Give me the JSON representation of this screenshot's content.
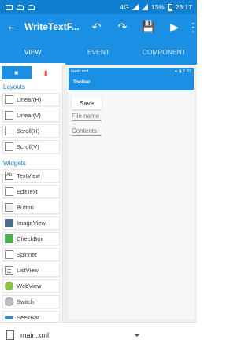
{
  "status_bar": {
    "battery": "13%",
    "time": "23:17",
    "network": "4G"
  },
  "app_bar": {
    "title": "WriteTextF..."
  },
  "tabs": [
    {
      "label": "VIEW",
      "active": true
    },
    {
      "label": "EVENT",
      "active": false
    },
    {
      "label": "COMPONENT",
      "active": false
    }
  ],
  "palette": {
    "layouts_header": "Layouts",
    "layouts": [
      "Linear(H)",
      "Linear(V)",
      "Scroll(H)",
      "Scroll(V)"
    ],
    "widgets_header": "Widgets",
    "widgets": [
      "TextView",
      "EditText",
      "Button",
      "ImageView",
      "CheckBox",
      "Spinner",
      "ListView",
      "WebView",
      "Switch",
      "SeekBar"
    ]
  },
  "preview": {
    "file_name": "main.xml",
    "time": "1:37",
    "toolbar_title": "Toolbar",
    "button_label": "Save",
    "field1_hint": "File name",
    "field2_hint": "Contents"
  },
  "bottom_bar": {
    "file": "main.xml"
  },
  "colors": {
    "primary": "#1a8fe3",
    "status_bar": "#0f7fd1",
    "section": "#1b7bc6"
  }
}
